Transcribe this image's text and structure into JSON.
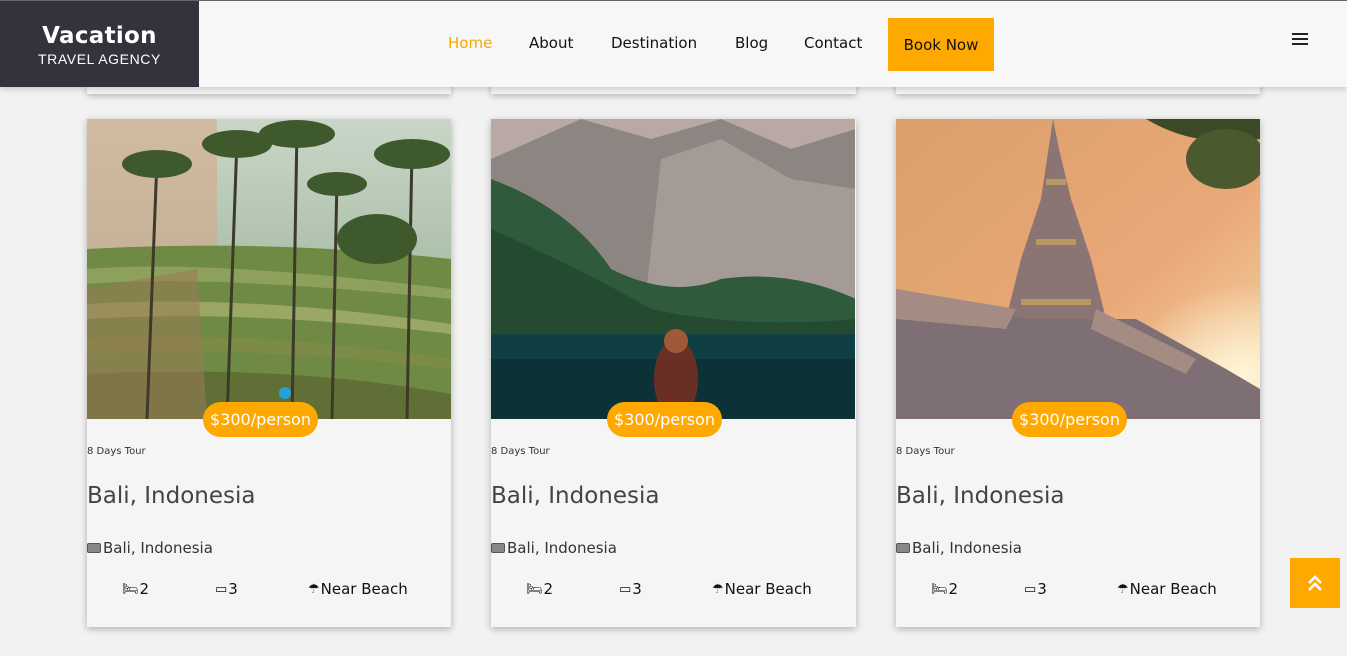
{
  "brand": {
    "name": "Vacation",
    "tagline": "TRAVEL AGENCY"
  },
  "nav": {
    "links": [
      {
        "label": "Home",
        "active": true
      },
      {
        "label": "About"
      },
      {
        "label": "Destination"
      },
      {
        "label": "Blog"
      },
      {
        "label": "Contact"
      }
    ],
    "cta_label": "Book Now"
  },
  "colors": {
    "accent": "#ffa800",
    "brand_bg": "#34333d",
    "page_bg": "#f2f2f2"
  },
  "cards": [
    {
      "image": "rice-terraces-photo",
      "price": "$300/person",
      "duration": "8 Days Tour",
      "title": "Bali, Indonesia",
      "location": "Bali, Indonesia",
      "beds": "2",
      "baths": "3",
      "feature": "Near Beach"
    },
    {
      "image": "mountain-lake-photo",
      "price": "$300/person",
      "duration": "8 Days Tour",
      "title": "Bali, Indonesia",
      "location": "Bali, Indonesia",
      "beds": "2",
      "baths": "3",
      "feature": "Near Beach"
    },
    {
      "image": "temple-sunset-photo",
      "price": "$300/person",
      "duration": "8 Days Tour",
      "title": "Bali, Indonesia",
      "location": "Bali, Indonesia",
      "beds": "2",
      "baths": "3",
      "feature": "Near Beach"
    }
  ],
  "icons": {
    "menu": "hamburger-icon",
    "scroll_top": "double-chevron-up-icon",
    "location": "map-icon",
    "bed": "bed-icon",
    "bath": "bath-icon",
    "beach": "beach-umbrella-icon"
  }
}
